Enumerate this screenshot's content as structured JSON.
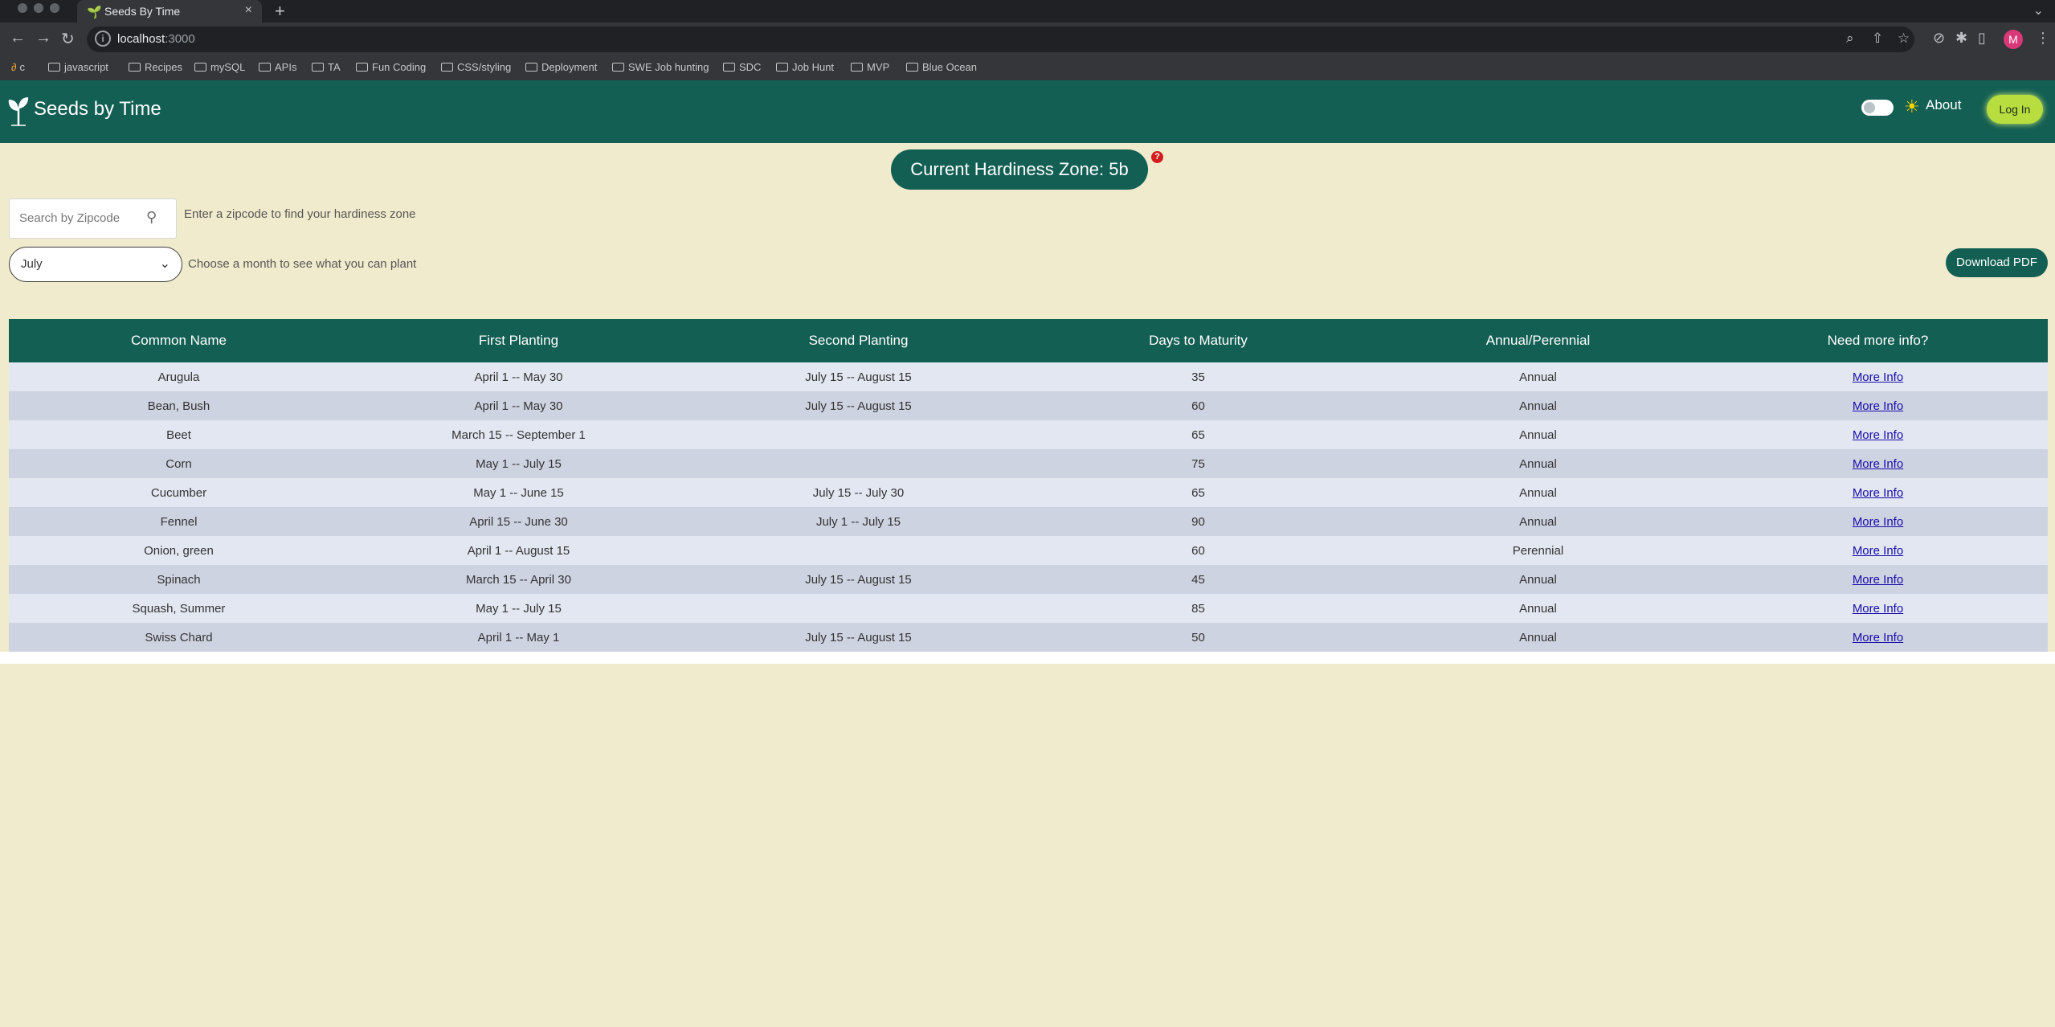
{
  "browser": {
    "tab_title": "Seeds By Time",
    "new_tab": "+",
    "url_host": "localhost",
    "url_port": ":3000",
    "profile_initial": "M",
    "bookmarks": [
      "c",
      "javascript",
      "Recipes",
      "mySQL",
      "APIs",
      "TA",
      "Fun Coding",
      "CSS/styling",
      "Deployment",
      "SWE Job hunting",
      "SDC",
      "Job Hunt",
      "MVP",
      "Blue Ocean"
    ]
  },
  "header": {
    "brand": "Seeds by Time",
    "about": "About",
    "login": "Log In",
    "dark_mode_on": false
  },
  "zone": {
    "label": "Current Hardiness Zone: 5b",
    "help": "?"
  },
  "search": {
    "placeholder": "Search by Zipcode",
    "hint": "Enter a zipcode to find your hardiness zone"
  },
  "month": {
    "value": "July",
    "hint": "Choose a month to see what you can plant"
  },
  "download": "Download PDF",
  "table": {
    "headers": [
      "Common Name",
      "First Planting",
      "Second Planting",
      "Days to Maturity",
      "Annual/Perennial",
      "Need more info?"
    ],
    "rows": [
      [
        "Arugula",
        "April 1 -- May 30",
        "July 15 -- August 15",
        "35",
        "Annual",
        "More Info"
      ],
      [
        "Bean, Bush",
        "April 1 -- May 30",
        "July 15 -- August 15",
        "60",
        "Annual",
        "More Info"
      ],
      [
        "Beet",
        "March 15 -- September 1",
        "",
        "65",
        "Annual",
        "More Info"
      ],
      [
        "Corn",
        "May 1 -- July 15",
        "",
        "75",
        "Annual",
        "More Info"
      ],
      [
        "Cucumber",
        "May 1 -- June 15",
        "July 15 -- July 30",
        "65",
        "Annual",
        "More Info"
      ],
      [
        "Fennel",
        "April 15 -- June 30",
        "July 1 -- July 15",
        "90",
        "Annual",
        "More Info"
      ],
      [
        "Onion, green",
        "April 1 -- August 15",
        "",
        "60",
        "Perennial",
        "More Info"
      ],
      [
        "Spinach",
        "March 15 -- April 30",
        "July 15 -- August 15",
        "45",
        "Annual",
        "More Info"
      ],
      [
        "Squash, Summer",
        "May 1 -- July 15",
        "",
        "85",
        "Annual",
        "More Info"
      ],
      [
        "Swiss Chard",
        "April 1 -- May 1",
        "July 15 -- August 15",
        "50",
        "Annual",
        "More Info"
      ]
    ]
  },
  "colors": {
    "brand_green": "#135f54",
    "page_bg": "#f1ebcd",
    "login_bg": "#b7dd3e",
    "row_odd": "#e2e7f1",
    "row_even": "#cdd3e1"
  }
}
